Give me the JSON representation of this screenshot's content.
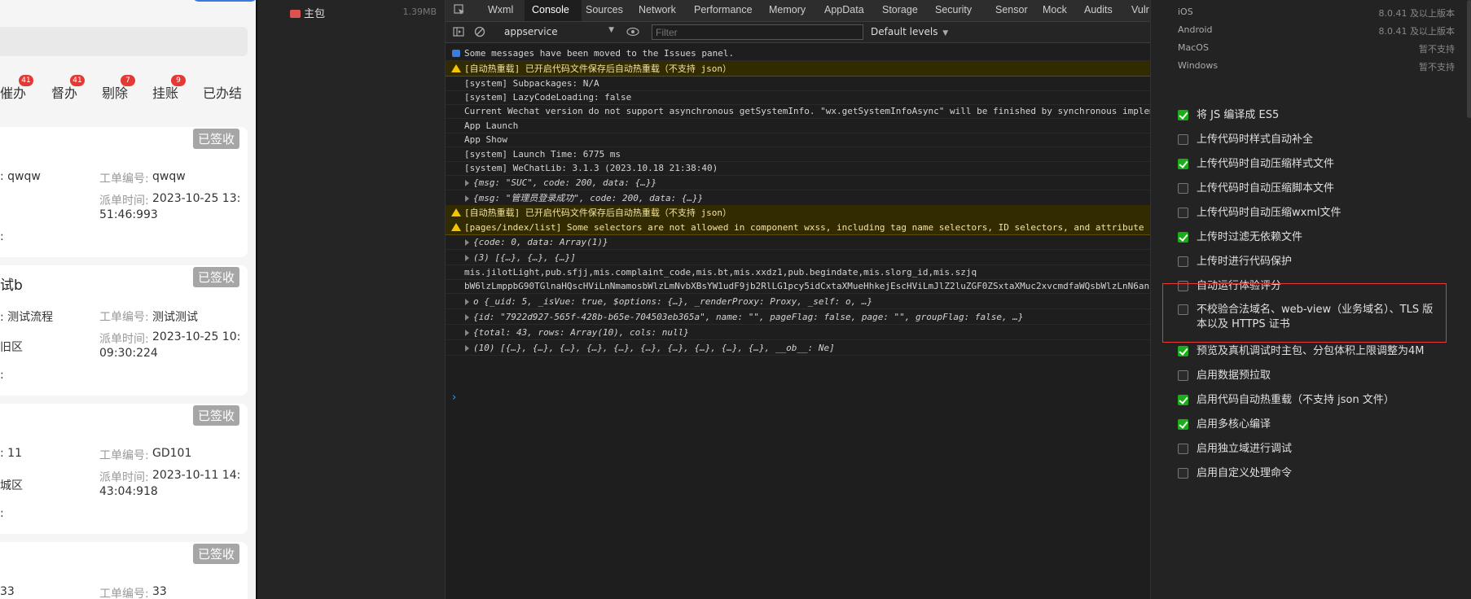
{
  "simulator": {
    "tabs": [
      {
        "label": "催办",
        "badge": "41"
      },
      {
        "label": "督办",
        "badge": "41"
      },
      {
        "label": "剔除",
        "badge": "7"
      },
      {
        "label": "挂账",
        "badge": "9"
      },
      {
        "label": "已办结",
        "badge": ""
      }
    ],
    "cards": [
      {
        "stamp": "已签收",
        "title": "",
        "left1": ": qwqw",
        "left2": "",
        "left3": ":",
        "label_no": "工单编号:",
        "no": "qwqw",
        "label_time": "派单时间:",
        "time1": "2023-10-25 13:",
        "time2": "51:46:993"
      },
      {
        "stamp": "已签收",
        "title": "试b",
        "left1": ": 测试流程",
        "left2": "旧区",
        "left3": ":",
        "label_no": "工单编号:",
        "no": "测试测试",
        "label_time": "派单时间:",
        "time1": "2023-10-25 10:",
        "time2": "09:30:224"
      },
      {
        "stamp": "已签收",
        "title": "",
        "left1": ": 11",
        "left2": "城区",
        "left3": ":",
        "label_no": "工单编号:",
        "no": "GD101",
        "label_time": "派单时间:",
        "time1": "2023-10-11 14:",
        "time2": "43:04:918"
      },
      {
        "stamp": "已签收",
        "title": "",
        "left1": "33",
        "left2": "",
        "left3": "",
        "label_no": "工单编号:",
        "no": "33",
        "label_time": "",
        "time1": "",
        "time2": ""
      }
    ]
  },
  "tree": {
    "name": "主包",
    "size": "1.39MB"
  },
  "devtools": {
    "tabs": [
      "Wxml",
      "Console",
      "Sources",
      "Network",
      "Performance",
      "Memory",
      "AppData",
      "Storage",
      "Security",
      "Sensor",
      "Mock",
      "Audits",
      "Vulr"
    ],
    "active_tab": "Console",
    "context": "appservice",
    "filter_placeholder": "Filter",
    "levels": "Default levels",
    "logs": [
      {
        "type": "info",
        "text": "Some messages have been moved to the Issues panel."
      },
      {
        "type": "warn",
        "text": "[自动热重载] 已开启代码文件保存后自动热重载（不支持 json）"
      },
      {
        "type": "log",
        "text": "[system] Subpackages: N/A"
      },
      {
        "type": "log",
        "text": "[system] LazyCodeLoading: false"
      },
      {
        "type": "log",
        "text": "Current Wechat version do not support asynchronous getSystemInfo. \"wx.getSystemInfoAsync\" will be finished by synchronous implem"
      },
      {
        "type": "log",
        "text": "App Launch"
      },
      {
        "type": "log",
        "text": "App Show"
      },
      {
        "type": "log",
        "text": "[system] Launch Time: 6775 ms"
      },
      {
        "type": "log",
        "text": "[system] WeChatLib: 3.1.3 (2023.10.18 21:38:40)"
      },
      {
        "type": "obj",
        "text": "{msg: \"SUC\", code: 200, data: {…}}"
      },
      {
        "type": "obj",
        "text": "{msg: \"管理员登录成功\", code: 200, data: {…}}"
      },
      {
        "type": "warn",
        "text": "[自动热重载] 已开启代码文件保存后自动热重载（不支持 json）"
      },
      {
        "type": "warn",
        "text": "[pages/index/list] Some selectors are not allowed in component wxss, including tag name selectors, ID selectors, and attribute s"
      },
      {
        "type": "obj",
        "text": "{code: 0, data: Array(1)}"
      },
      {
        "type": "obj",
        "text": "(3) [{…}, {…}, {…}]"
      },
      {
        "type": "log",
        "text": "mis.jilotLight,pub.sfjj,mis.complaint_code,mis.bt,mis.xxdz1,pub.begindate,mis.slorg_id,mis.szjq"
      },
      {
        "type": "log",
        "text": "bW6lzLmppbG90TGlnaHQscHViLnNmamosbWlzLmNvbXBsYW1udF9jb2RlLG1pcy5idCxtaXMueHhkejEscHViLmJlZ2luZGF0ZSxtaXMuc2xvcmdfaWQsbWlzLnN6anE"
      },
      {
        "type": "obj",
        "text": "o {_uid: 5, _isVue: true, $options: {…}, _renderProxy: Proxy, _self: o, …}"
      },
      {
        "type": "obj",
        "text": "{id: \"7922d927-565f-428b-b65e-704503eb365a\", name: \"\", pageFlag: false, page: \"\", groupFlag: false, …}"
      },
      {
        "type": "obj",
        "text": "{total: 43, rows: Array(10), cols: null}"
      },
      {
        "type": "obj",
        "text": "(10) [{…}, {…}, {…}, {…}, {…}, {…}, {…}, {…}, {…}, {…}, __ob__: Ne]"
      }
    ],
    "prompt": "›"
  },
  "settings": {
    "systems": [
      {
        "name": "iOS",
        "value": "8.0.41 及以上版本"
      },
      {
        "name": "Android",
        "value": "8.0.41 及以上版本"
      },
      {
        "name": "MacOS",
        "value": "暂不支持"
      },
      {
        "name": "Windows",
        "value": "暂不支持"
      }
    ],
    "options": [
      {
        "label": "将 JS 编译成 ES5",
        "checked": true
      },
      {
        "label": "上传代码时样式自动补全",
        "checked": false
      },
      {
        "label": "上传代码时自动压缩样式文件",
        "checked": true
      },
      {
        "label": "上传代码时自动压缩脚本文件",
        "checked": false
      },
      {
        "label": "上传代码时自动压缩wxml文件",
        "checked": false
      },
      {
        "label": "上传时过滤无依赖文件",
        "checked": true
      },
      {
        "label": "上传时进行代码保护",
        "checked": false
      },
      {
        "label": "自动运行体验评分",
        "checked": false
      },
      {
        "label": "不校验合法域名、web-view（业务域名）、TLS 版",
        "label2": "本以及 HTTPS 证书",
        "checked": false
      },
      {
        "label": "预览及真机调试时主包、分包体积上限调整为4M",
        "checked": true
      },
      {
        "label": "启用数据预拉取",
        "checked": false
      },
      {
        "label": "启用代码自动热重载（不支持 json 文件）",
        "checked": true
      },
      {
        "label": "启用多核心编译",
        "checked": true
      },
      {
        "label": "启用独立域进行调试",
        "checked": false
      },
      {
        "label": "启用自定义处理命令",
        "checked": false
      }
    ]
  }
}
